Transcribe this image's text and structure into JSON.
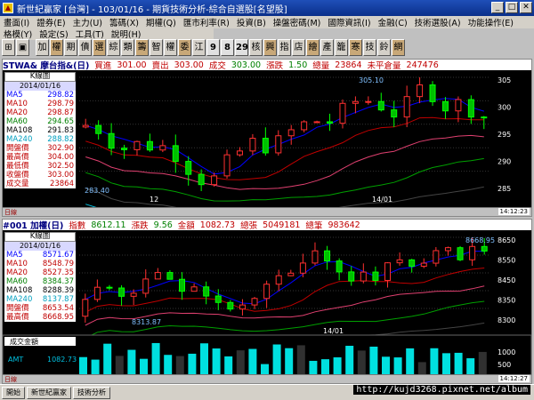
{
  "window": {
    "title": "新世紀贏家 [台灣] - 103/01/16 - 期貨技術分析-綜合自選股[名望股]"
  },
  "menu1": [
    "畫面(I)",
    "證券(E)",
    "主力(U)",
    "籌碼(X)",
    "期權(Q)",
    "匯市利率(R)",
    "投資(B)",
    "操盤密碼(M)",
    "國際資訊(I)",
    "金融(C)",
    "技術選股(A)",
    "功能操作(E)"
  ],
  "menu2": [
    "格模(Y)",
    "設定(S)",
    "工具(T)",
    "說明(H)"
  ],
  "toolbar_left": [
    "⊞",
    "▣"
  ],
  "toolbar": [
    "加",
    "權",
    "期",
    "債",
    "選",
    "綜",
    "類",
    "籌",
    "智",
    "權",
    "委",
    "江",
    "9",
    "8",
    "29",
    "核",
    "興",
    "指",
    "店",
    "繪",
    "產",
    "籠",
    "寒",
    "技",
    "鈴",
    "網"
  ],
  "panel1": {
    "info": [
      {
        "t": "STWA& 摩台指&(日)",
        "c": "#000080"
      },
      {
        "t": "買進",
        "c": "#c00000"
      },
      {
        "t": "301.00",
        "c": "#c00000"
      },
      {
        "t": "賣出",
        "c": "#c00000"
      },
      {
        "t": "303.00",
        "c": "#c00000"
      },
      {
        "t": "成交",
        "c": "#c00000"
      },
      {
        "t": "303.00",
        "c": "#008000"
      },
      {
        "t": "漲跌",
        "c": "#c00000"
      },
      {
        "t": "1.50",
        "c": "#008000"
      },
      {
        "t": "總量",
        "c": "#c00000"
      },
      {
        "t": "23864",
        "c": "#c00000"
      },
      {
        "t": "未平倉量",
        "c": "#c00000"
      },
      {
        "t": "247476",
        "c": "#c00000"
      }
    ],
    "side": {
      "header": "K線圖",
      "date": "2014/01/16",
      "rows": [
        {
          "k": "MA5",
          "v": "298.82",
          "c": "#0000ff"
        },
        {
          "k": "MA10",
          "v": "298.79",
          "c": "#c00000"
        },
        {
          "k": "MA20",
          "v": "298.87",
          "c": "#c00000"
        },
        {
          "k": "MA60",
          "v": "294.65",
          "c": "#008000"
        },
        {
          "k": "MA108",
          "v": "291.83",
          "c": "#000000"
        },
        {
          "k": "MA240",
          "v": "288.82",
          "c": "#00a0c0"
        },
        {
          "k": "開盤價",
          "v": "302.90",
          "c": "#c00000"
        },
        {
          "k": "最高價",
          "v": "304.00",
          "c": "#c00000"
        },
        {
          "k": "最低價",
          "v": "302.50",
          "c": "#c00000"
        },
        {
          "k": "收盤價",
          "v": "303.00",
          "c": "#c00000"
        },
        {
          "k": "成交量",
          "v": "23864",
          "c": "#c00000"
        }
      ]
    },
    "yticks": [
      "305",
      "300",
      "295",
      "290",
      "285"
    ],
    "xlabels": [
      "12",
      "14/01"
    ],
    "annot_hi": "305.10",
    "annot_lo": "283.40",
    "status_left": "日線",
    "status_right": "14:12:23"
  },
  "panel2": {
    "info": [
      {
        "t": "#001 加權(日)",
        "c": "#000080"
      },
      {
        "t": "指數",
        "c": "#c00000"
      },
      {
        "t": "8612.11",
        "c": "#008000"
      },
      {
        "t": "漲跌",
        "c": "#c00000"
      },
      {
        "t": "9.56",
        "c": "#008000"
      },
      {
        "t": "金額",
        "c": "#c00000"
      },
      {
        "t": "1082.73",
        "c": "#c00000"
      },
      {
        "t": "總張",
        "c": "#c00000"
      },
      {
        "t": "5049181",
        "c": "#c00000"
      },
      {
        "t": "總筆",
        "c": "#c00000"
      },
      {
        "t": "983642",
        "c": "#c00000"
      }
    ],
    "side": {
      "header": "K線圖",
      "date": "2014/01/16",
      "rows": [
        {
          "k": "MA5",
          "v": "8571.67",
          "c": "#0000ff"
        },
        {
          "k": "MA10",
          "v": "8548.79",
          "c": "#c00000"
        },
        {
          "k": "MA20",
          "v": "8527.35",
          "c": "#c00000"
        },
        {
          "k": "MA60",
          "v": "8384.37",
          "c": "#008000"
        },
        {
          "k": "MA108",
          "v": "8288.39",
          "c": "#000000"
        },
        {
          "k": "MA240",
          "v": "8137.87",
          "c": "#00a0c0"
        },
        {
          "k": "開盤價",
          "v": "8653.54",
          "c": "#c00000"
        },
        {
          "k": "最高價",
          "v": "8668.95",
          "c": "#c00000"
        }
      ]
    },
    "yticks": [
      "8650",
      "8550",
      "8450",
      "8350",
      "8300"
    ],
    "xlabels": [
      "14/01"
    ],
    "annot_hi": "8668.95",
    "annot_lo": "8313.87",
    "vol": {
      "header": "成交金額",
      "k": "AMT",
      "v": "1082.73",
      "yticks": [
        "1000",
        "500"
      ]
    },
    "status_left": "日線",
    "status_right": "14:12:27"
  },
  "taskbar": [
    "開始",
    "新世紀贏家",
    "技術分析"
  ],
  "watermark": "http://kujd3268.pixnet.net/album"
}
